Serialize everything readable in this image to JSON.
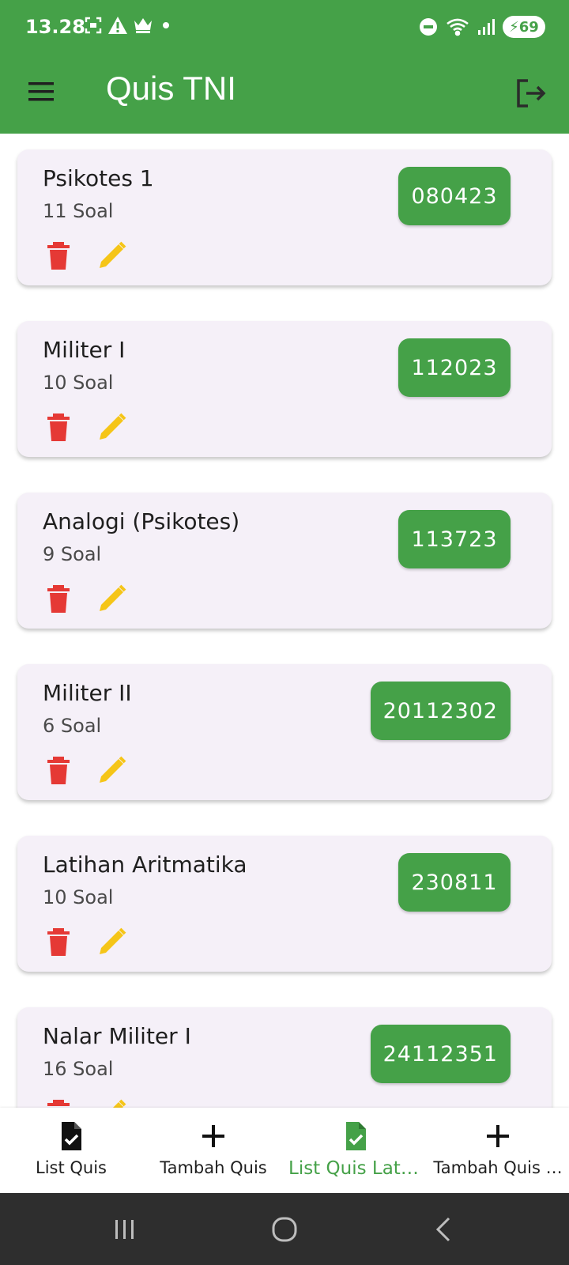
{
  "status_bar": {
    "time": "13.28",
    "battery": "69"
  },
  "app_bar": {
    "title": "Quis TNI"
  },
  "quizzes": [
    {
      "title": "Psikotes 1",
      "count": "11 Soal",
      "code": "080423"
    },
    {
      "title": "Militer I",
      "count": "10 Soal",
      "code": "112023"
    },
    {
      "title": "Analogi (Psikotes)",
      "count": "9 Soal",
      "code": "113723"
    },
    {
      "title": "Militer II",
      "count": "6 Soal",
      "code": "20112302"
    },
    {
      "title": "Latihan Aritmatika",
      "count": "10 Soal",
      "code": "230811"
    },
    {
      "title": "Nalar Militer I",
      "count": "16 Soal",
      "code": "24112351"
    }
  ],
  "bottom_nav": {
    "items": [
      {
        "label": "List Quis",
        "icon": "document-check-icon"
      },
      {
        "label": "Tambah Quis",
        "icon": "plus-icon"
      },
      {
        "label": "List Quis Lati…",
        "icon": "document-check-icon",
        "active": true
      },
      {
        "label": "Tambah Quis …",
        "icon": "plus-icon"
      }
    ]
  },
  "colors": {
    "primary": "#45a148",
    "delete": "#e53935",
    "edit": "#f5c518",
    "card_bg": "#f5f0f8"
  }
}
